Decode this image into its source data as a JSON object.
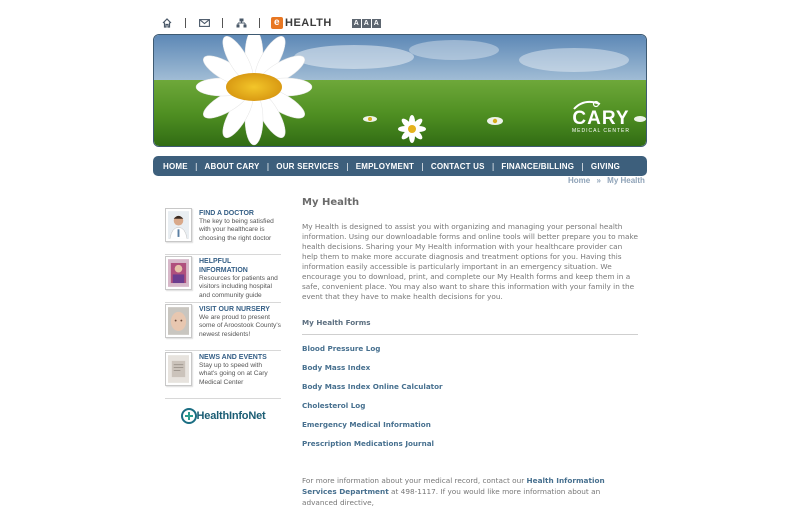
{
  "utility": {
    "icons": [
      "home-icon",
      "mail-icon",
      "sitemap-icon"
    ],
    "ehealth_badge": "e",
    "ehealth_label": "HEALTH",
    "text_sizes": [
      "A",
      "A",
      "A"
    ]
  },
  "banner": {
    "logo_word": "CARY",
    "logo_sub": "MEDICAL CENTER"
  },
  "nav": {
    "items": [
      "HOME",
      "ABOUT CARY",
      "OUR SERVICES",
      "EMPLOYMENT",
      "CONTACT US",
      "FINANCE/BILLING",
      "GIVING"
    ],
    "separator": "|"
  },
  "breadcrumb": {
    "home": "Home",
    "separator": "»",
    "current": "My Health"
  },
  "sidebar": {
    "items": [
      {
        "title": "FIND A DOCTOR",
        "desc": "The key to being satisfied with your healthcare is choosing the right doctor"
      },
      {
        "title": "HELPFUL INFORMATION",
        "desc": "Resources for patients and visitors including hospital and community guide"
      },
      {
        "title": "VISIT OUR NURSERY",
        "desc": "We are proud to present some of Aroostook County's newest residents!"
      },
      {
        "title": "NEWS AND EVENTS",
        "desc": "Stay up to speed with what's going on at Cary Medical Center"
      }
    ],
    "partner_logo": "HealthInfoNet"
  },
  "main": {
    "title": "My Health",
    "intro": "My Health is designed to assist you with organizing and managing your personal health information.  Using our downloadable forms and online tools will better prepare you to make health decisions.  Sharing your My Health information with your healthcare provider can help them to make more accurate diagnosis and treatment options for you.  Having this information easily accessible is particularly important in an emergency situation.  We encourage you to download, print, and complete our My Health forms and keep them in a safe, convenient place.  You may also want to share this information with your family in the event that they have to make health decisions for you.",
    "forms_heading": "My Health Forms",
    "forms": [
      "Blood Pressure Log",
      "Body Mass Index",
      "Body Mass Index Online Calculator",
      "Cholesterol Log",
      "Emergency Medical Information",
      "Prescription Medications Journal"
    ],
    "more_pre": "For more information about your medical record, contact our ",
    "more_link": "Health Information Services Department",
    "more_post": " at 498-1117.   If you would like more information about an advanced directive,"
  },
  "colors": {
    "nav_bg": "#3d5f7c",
    "link": "#47708f",
    "accent_orange": "#e87722"
  }
}
